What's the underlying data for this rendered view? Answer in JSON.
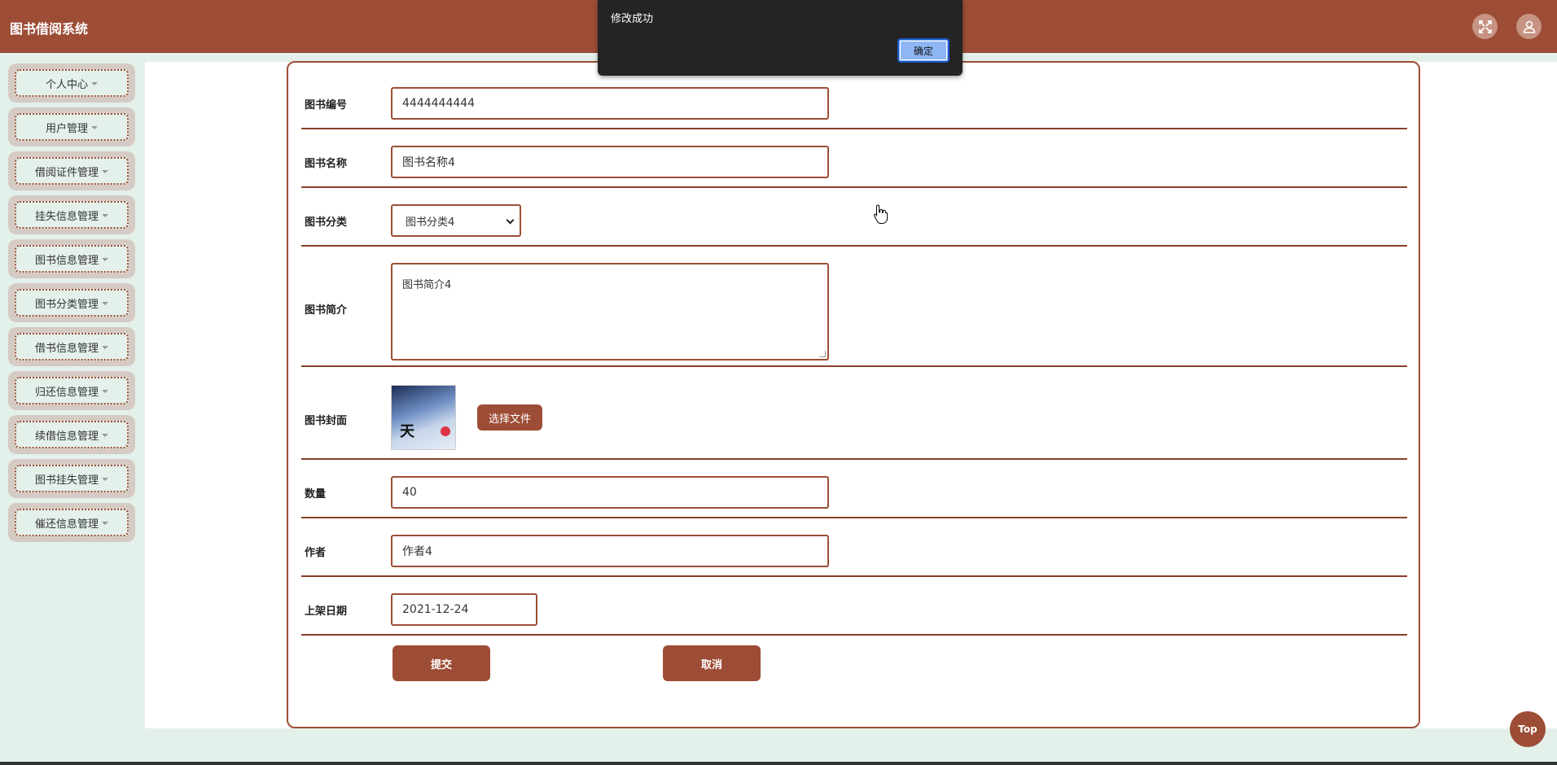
{
  "app": {
    "title": "图书借阅系统"
  },
  "header": {
    "fullscreen_icon": "fullscreen-icon",
    "user_icon": "user-icon"
  },
  "sidebar": {
    "items": [
      {
        "label": "个人中心"
      },
      {
        "label": "用户管理"
      },
      {
        "label": "借阅证件管理"
      },
      {
        "label": "挂失信息管理"
      },
      {
        "label": "图书信息管理"
      },
      {
        "label": "图书分类管理"
      },
      {
        "label": "借书信息管理"
      },
      {
        "label": "归还信息管理"
      },
      {
        "label": "续借信息管理"
      },
      {
        "label": "图书挂失管理"
      },
      {
        "label": "催还信息管理"
      }
    ]
  },
  "form": {
    "book_number": {
      "label": "图书编号",
      "value": "4444444444"
    },
    "book_name": {
      "label": "图书名称",
      "value": "图书名称4"
    },
    "book_category": {
      "label": "图书分类",
      "value": "图书分类4"
    },
    "book_intro": {
      "label": "图书简介",
      "value": "图书简介4"
    },
    "book_cover": {
      "label": "图书封面",
      "button": "选择文件",
      "cover_text": "天"
    },
    "quantity": {
      "label": "数量",
      "value": "40"
    },
    "author": {
      "label": "作者",
      "value": "作者4"
    },
    "shelf_date": {
      "label": "上架日期",
      "value": "2021-12-24"
    },
    "submit": "提交",
    "cancel": "取消"
  },
  "alert": {
    "message": "修改成功",
    "ok": "确定"
  },
  "top_button": "Top",
  "colors": {
    "primary": "#9d4d36",
    "background": "#e4f0ea"
  }
}
